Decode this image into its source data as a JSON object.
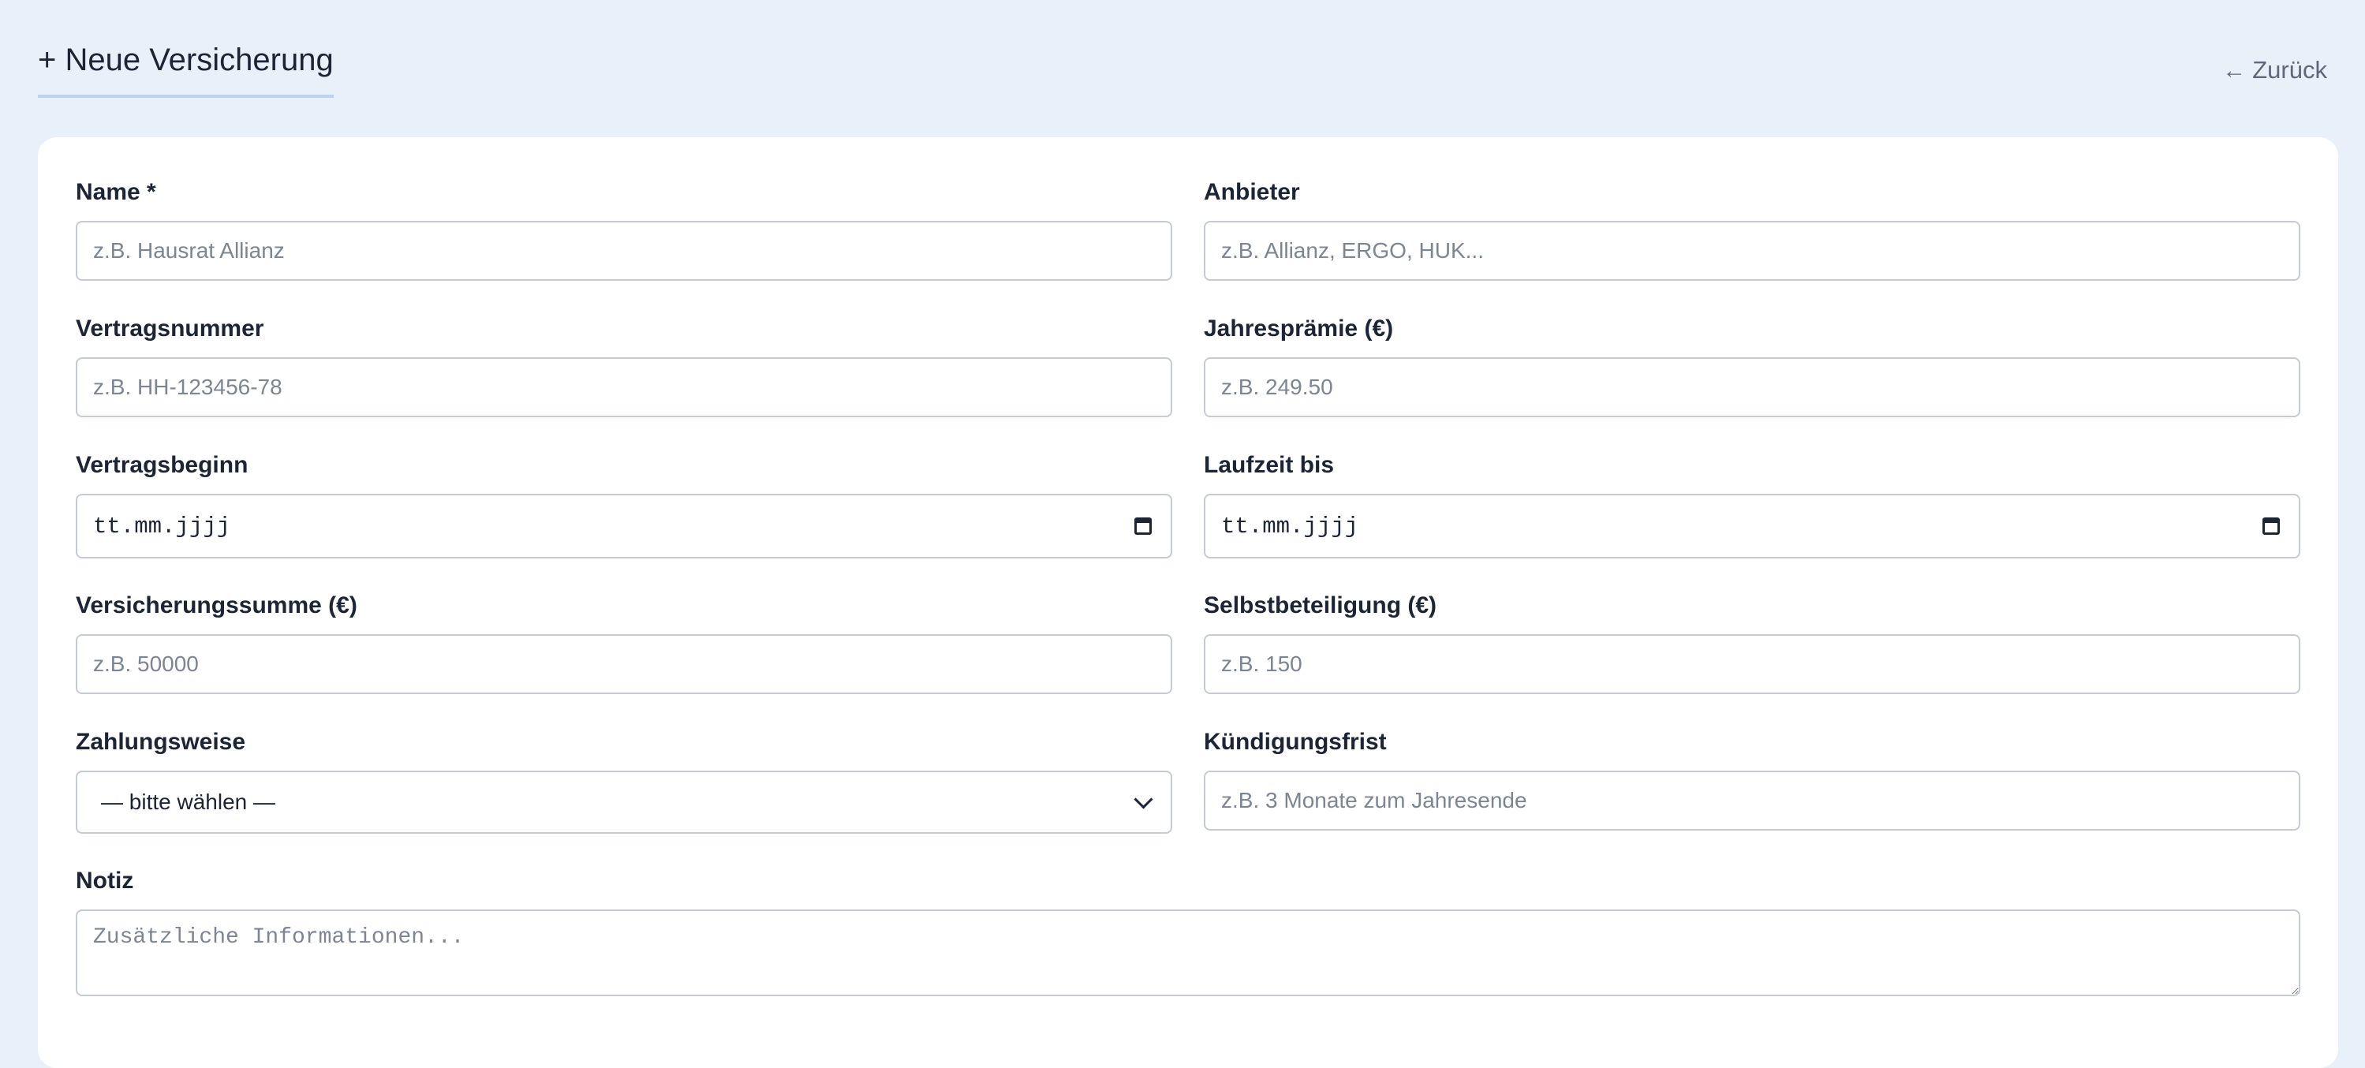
{
  "header": {
    "title": "+ Neue Versicherung",
    "back_arrow": "←",
    "back_label": "Zurück"
  },
  "form": {
    "name": {
      "label": "Name *",
      "placeholder": "z.B. Hausrat Allianz",
      "value": ""
    },
    "anbieter": {
      "label": "Anbieter",
      "placeholder": "z.B. Allianz, ERGO, HUK...",
      "value": ""
    },
    "vertragsnummer": {
      "label": "Vertragsnummer",
      "placeholder": "z.B. HH-123456-78",
      "value": ""
    },
    "jahrespraemie": {
      "label": "Jahresprämie (€)",
      "placeholder": "z.B. 249.50",
      "value": ""
    },
    "vertragsbeginn": {
      "label": "Vertragsbeginn",
      "display": "tt.mm.jjjj"
    },
    "laufzeit_bis": {
      "label": "Laufzeit bis",
      "display": "tt.mm.jjjj"
    },
    "versicherungssumme": {
      "label": "Versicherungssumme (€)",
      "placeholder": "z.B. 50000",
      "value": ""
    },
    "selbstbeteiligung": {
      "label": "Selbstbeteiligung (€)",
      "placeholder": "z.B. 150",
      "value": ""
    },
    "zahlungsweise": {
      "label": "Zahlungsweise",
      "selected": "— bitte wählen —"
    },
    "kuendigungsfrist": {
      "label": "Kündigungsfrist",
      "placeholder": "z.B. 3 Monate zum Jahresende",
      "value": ""
    },
    "notiz": {
      "label": "Notiz",
      "placeholder": "Zusätzliche Informationen...",
      "value": ""
    }
  },
  "icons": {
    "date": "calendar-icon",
    "select": "chevron-down-icon",
    "back": "arrow-left-icon"
  },
  "colors": {
    "page_background": "#e8f0fa",
    "card_background": "#ffffff",
    "title_underline": "#bcd4f2",
    "input_border": "#c5cad3",
    "placeholder": "#7c8592",
    "text": "#1b2536",
    "muted_link": "#5f6878"
  }
}
